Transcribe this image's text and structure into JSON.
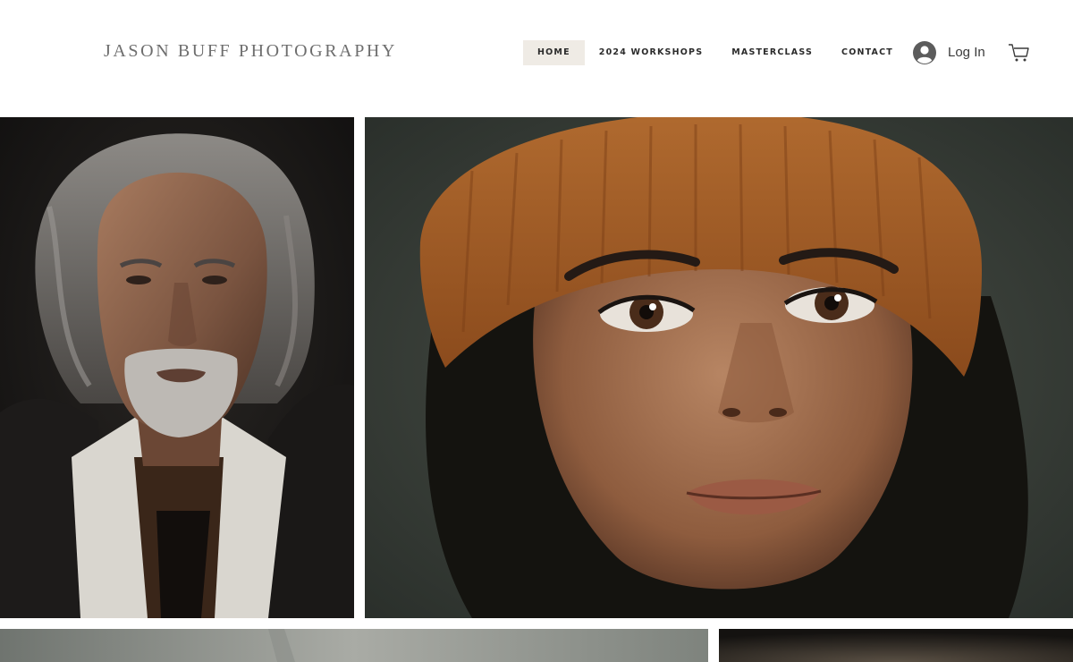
{
  "site": {
    "logo_text": "JASON BUFF PHOTOGRAPHY"
  },
  "nav": {
    "items": [
      {
        "label": "HOME",
        "active": true
      },
      {
        "label": "2024 WORKSHOPS",
        "active": false
      },
      {
        "label": "MASTERCLASS",
        "active": false
      },
      {
        "label": "CONTACT",
        "active": false
      }
    ]
  },
  "account": {
    "login_label": "Log In",
    "icon": "avatar-icon"
  },
  "cart": {
    "icon": "cart-icon"
  },
  "gallery": {
    "photos": [
      {
        "subject": "portrait of man with grey hair and beard"
      },
      {
        "subject": "portrait of woman in orange knit beanie"
      },
      {
        "subject": "misty grey landscape"
      },
      {
        "subject": "dark portrait"
      }
    ]
  },
  "colors": {
    "nav_active_bg": "#efebe5",
    "logo": "#6e6e6e",
    "text": "#2b2b2b",
    "beanie": "#a35a22"
  }
}
